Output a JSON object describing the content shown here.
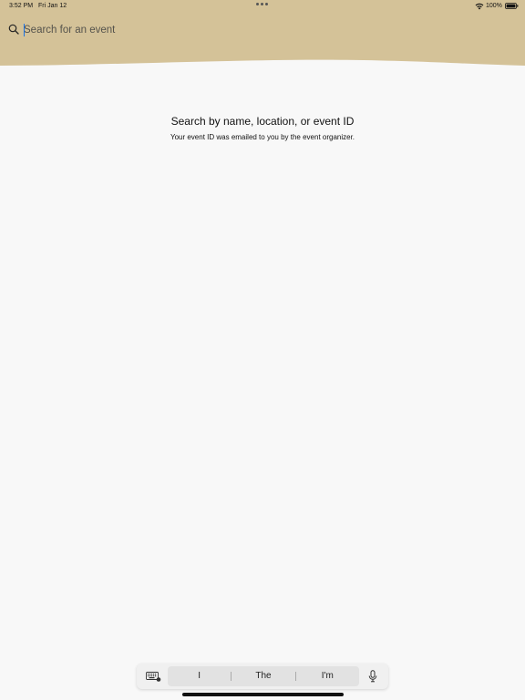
{
  "status_bar": {
    "time": "3:52 PM",
    "date": "Fri Jan 12",
    "battery": "100%",
    "icons": [
      "wifi-icon",
      "battery-icon"
    ]
  },
  "search": {
    "placeholder": "Search for an event",
    "value": "",
    "icon": "search-icon"
  },
  "empty_state": {
    "title": "Search by name, location, or event ID",
    "subtitle": "Your event ID was emailed to you by the event organizer."
  },
  "keyboard": {
    "suggestions": [
      "I",
      "The",
      "I'm"
    ],
    "icons": [
      "keyboard-icon",
      "microphone-icon"
    ]
  },
  "colors": {
    "header_bg": "#d4c298",
    "page_bg": "#f8f8f8",
    "cursor": "#1a73e8"
  }
}
